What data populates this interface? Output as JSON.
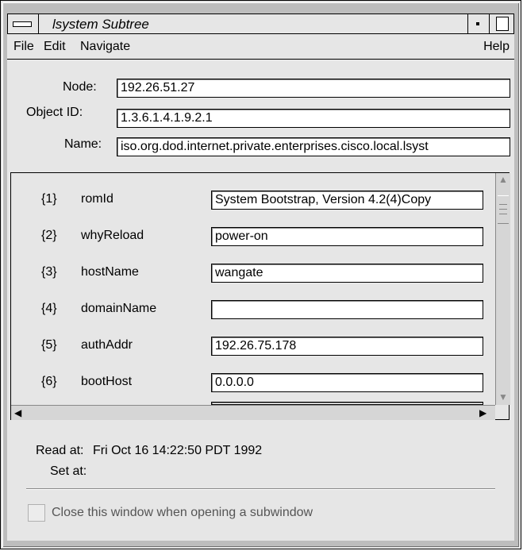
{
  "window": {
    "title": "lsystem Subtree"
  },
  "menubar": {
    "file": "File",
    "edit": "Edit",
    "navigate": "Navigate",
    "help": "Help"
  },
  "header": {
    "node_label": "Node:",
    "node_value": "192.26.51.27",
    "objectid_label": "Object ID:",
    "objectid_value": "1.3.6.1.4.1.9.2.1",
    "name_label": "Name:",
    "name_value": "iso.org.dod.internet.private.enterprises.cisco.local.lsyst"
  },
  "rows": [
    {
      "index": "{1}",
      "name": "romId",
      "value": "System Bootstrap, Version 4.2(4)Copy"
    },
    {
      "index": "{2}",
      "name": "whyReload",
      "value": "power-on"
    },
    {
      "index": "{3}",
      "name": "hostName",
      "value": "wangate"
    },
    {
      "index": "{4}",
      "name": "domainName",
      "value": ""
    },
    {
      "index": "{5}",
      "name": "authAddr",
      "value": "192.26.75.178"
    },
    {
      "index": "{6}",
      "name": "bootHost",
      "value": "0.0.0.0"
    }
  ],
  "status": {
    "read_label": "Read at:",
    "read_value": "Fri Oct 16 14:22:50 PDT 1992",
    "set_label": "Set at:",
    "set_value": ""
  },
  "options": {
    "close_on_subwindow_label": "Close this window when opening a subwindow",
    "close_on_subwindow_checked": false
  },
  "colors": {
    "window_bg": "#e6e6e6",
    "field_bg": "#ffffff",
    "disabled_text": "#555555"
  },
  "icons": {
    "window_menu": "window-menu-icon",
    "minimize": "minimize-icon",
    "maximize": "maximize-icon",
    "scroll_up": "arrow-up-icon",
    "scroll_down": "arrow-down-icon",
    "scroll_left": "arrow-left-icon",
    "scroll_right": "arrow-right-icon"
  }
}
